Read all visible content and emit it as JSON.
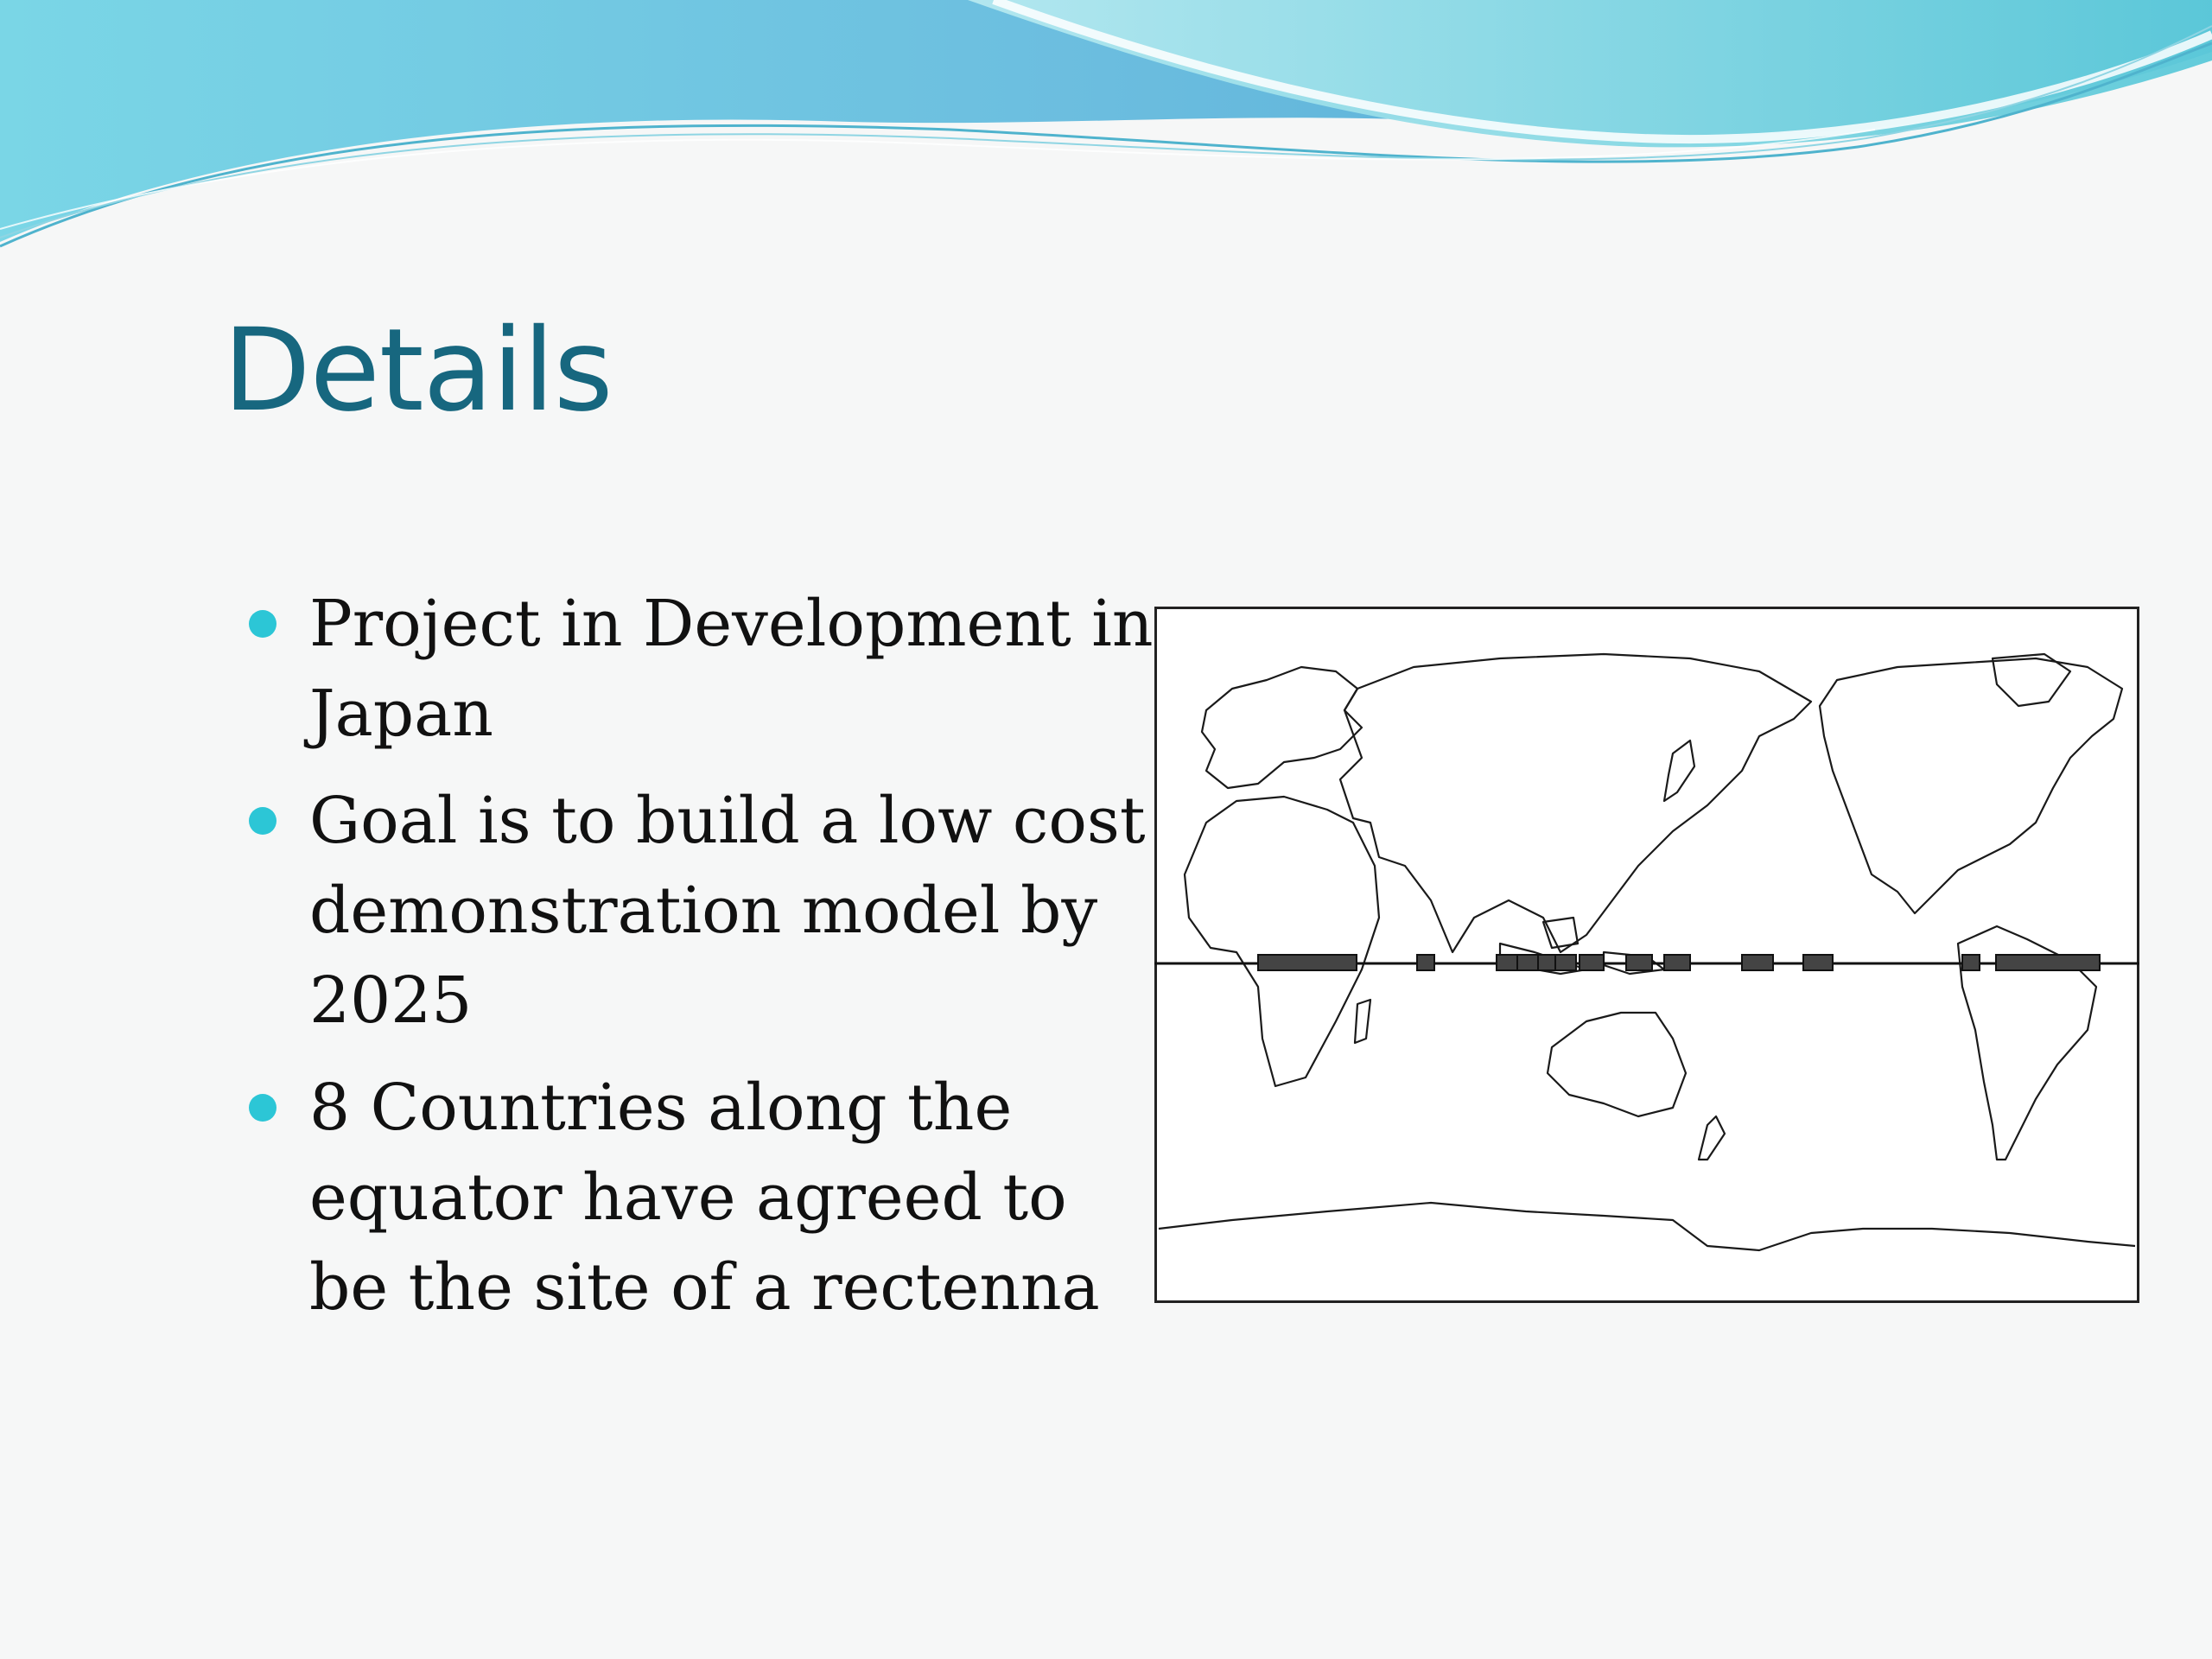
{
  "slide": {
    "title": "Details",
    "bullets": [
      {
        "text": "Project in Development in Japan"
      },
      {
        "text": "Goal is to build a low cost demonstration model by 2025"
      },
      {
        "text": "8 Countries along the equator have agreed to be the site of a rectenna"
      }
    ]
  },
  "colors": {
    "title": "#17677f",
    "bullet": "#2cc6d6",
    "body_text": "#111111",
    "background": "#f6f7f7",
    "wave_dark": "#5ab0d3",
    "wave_light": "#7fd9e4"
  },
  "icons": {
    "bullet": "filled-circle-bullet"
  }
}
